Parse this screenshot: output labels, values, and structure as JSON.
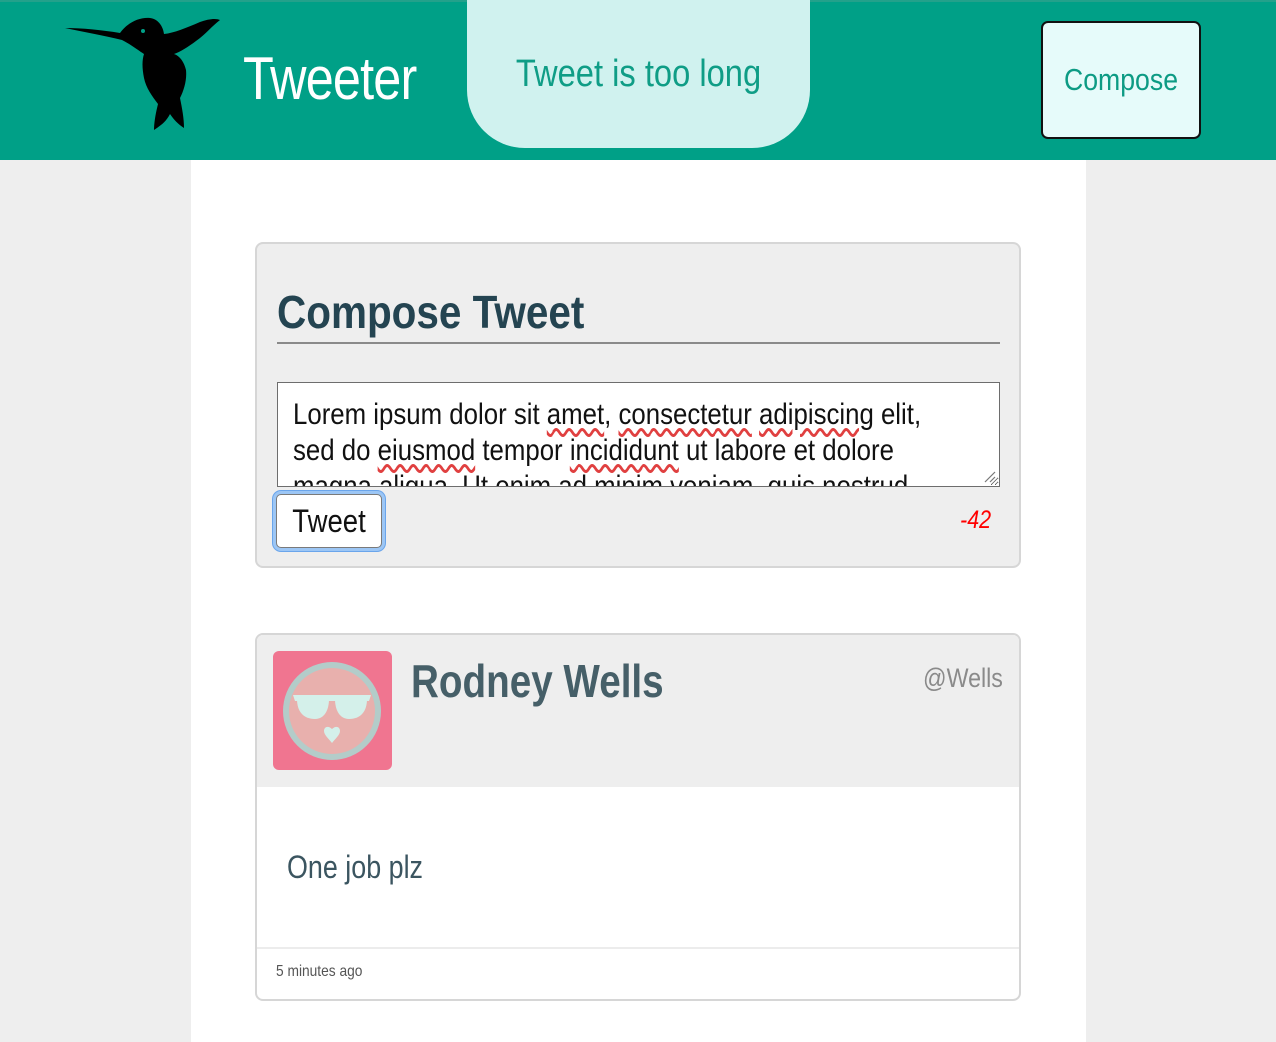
{
  "header": {
    "brand": "Tweeter",
    "error_message": "Tweet is too long",
    "compose_label": "Compose",
    "logo_icon": "hummingbird-icon",
    "colors": {
      "bar": "#00a087",
      "banner": "#d0f2ef",
      "compose_bg": "#e6fbfa"
    }
  },
  "compose": {
    "title": "Compose Tweet",
    "text_lines": [
      [
        "Lorem ipsum dolor sit ",
        {
          "w": "amet"
        },
        ", ",
        {
          "w": "consectetur"
        },
        " ",
        {
          "w": "adipiscing"
        },
        " elit,"
      ],
      [
        "sed do ",
        {
          "w": "eiusmod"
        },
        " tempor ",
        {
          "w": "incididunt"
        },
        " ut labore et dolore"
      ],
      [
        "magna aliqua. Ut enim ad minim veniam, quis nostrud"
      ]
    ],
    "tweet_button": "Tweet",
    "char_counter": "-42",
    "counter_color": "#ff0000"
  },
  "tweets": [
    {
      "name": "Rodney Wells",
      "handle": "@Wells",
      "avatar_icon": "sunglasses-face-avatar",
      "body": "One job plz",
      "time": "5 minutes ago"
    }
  ]
}
